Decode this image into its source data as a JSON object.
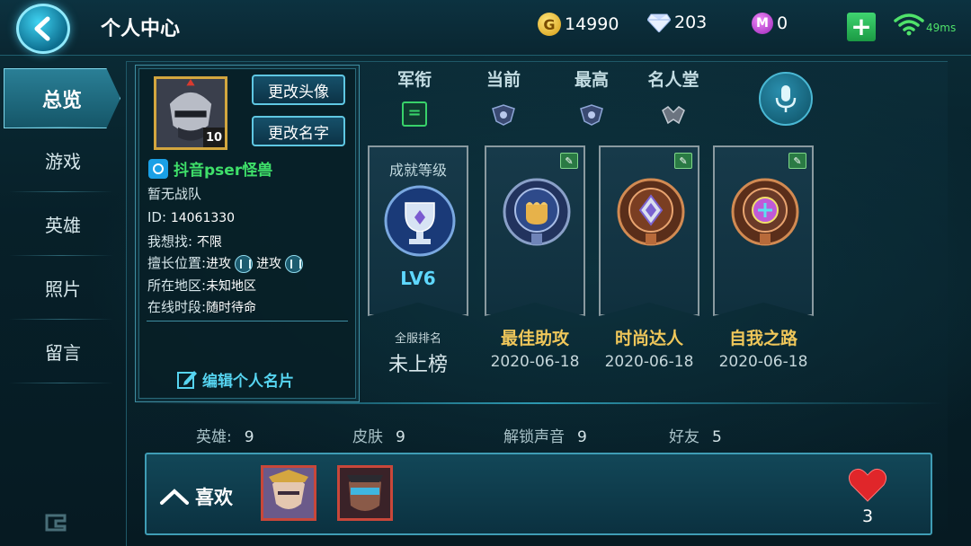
{
  "header": {
    "title": "个人中心",
    "gold": "14990",
    "diamonds": "203",
    "vouchers": "0",
    "coin_glyph": "G",
    "voucher_glyph": "M",
    "plus_glyph": "+",
    "ping": "49ms"
  },
  "sidebar": {
    "items": [
      {
        "label": "总览",
        "active": true
      },
      {
        "label": "游戏"
      },
      {
        "label": "英雄"
      },
      {
        "label": "照片"
      },
      {
        "label": "留言"
      }
    ]
  },
  "profile": {
    "level": "10",
    "change_avatar": "更改头像",
    "change_name": "更改名字",
    "nickname": "抖音pser怪兽",
    "team": "暂无战队",
    "id_label": "ID:",
    "id_value": "14061330",
    "looking_for_label": "我想找:",
    "looking_for_value": "不限",
    "positions_label": "擅长位置:",
    "position_1": "进攻",
    "position_2": "进攻",
    "region_label": "所在地区:",
    "region_value": "未知地区",
    "online_label": "在线时段:",
    "online_value": "随时待命",
    "edit_card": "编辑个人名片"
  },
  "ranks": {
    "military_rank": "军衔",
    "current": "当前",
    "highest": "最高",
    "hall_of_fame": "名人堂",
    "rank_symbol": "="
  },
  "achievements": {
    "level_title": "成就等级",
    "level_value": "LV6",
    "server_rank_label": "全服排名",
    "server_rank_value": "未上榜",
    "items": [
      {
        "name": "最佳助攻",
        "date": "2020-06-18"
      },
      {
        "name": "时尚达人",
        "date": "2020-06-18"
      },
      {
        "name": "自我之路",
        "date": "2020-06-18"
      }
    ]
  },
  "stats": {
    "heroes_label": "英雄:",
    "heroes_value": "9",
    "skins_label": "皮肤",
    "skins_value": "9",
    "voices_label": "解锁声音",
    "voices_value": "9",
    "friends_label": "好友",
    "friends_value": "5"
  },
  "likes": {
    "label": "喜欢",
    "count": "3"
  },
  "colors": {
    "accent": "#56d4f0",
    "gold_text": "#f0c75a",
    "nickname": "#3fe06a",
    "heart": "#e0262a"
  }
}
